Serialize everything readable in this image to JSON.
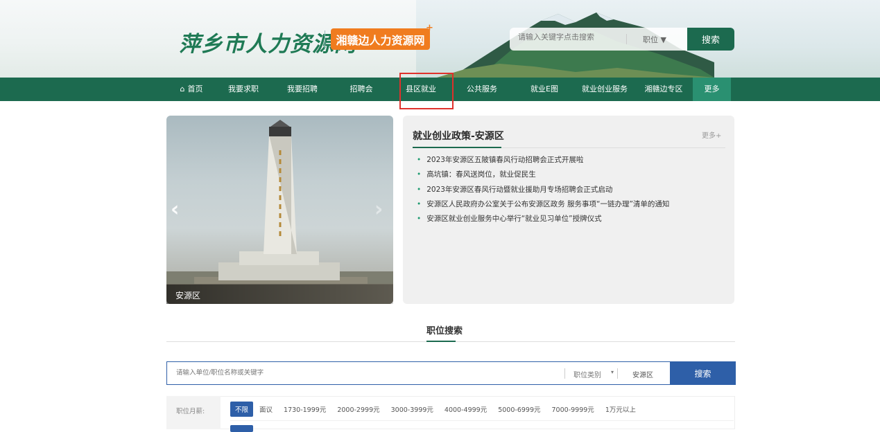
{
  "header": {
    "logo_text": "萍乡市人力资源网",
    "badge_text": "湘赣边人力资源网",
    "badge_plus": "+",
    "search_placeholder": "请输入关键字点击搜索",
    "search_category": "职位 ▼",
    "search_button": "搜索"
  },
  "nav": {
    "items": [
      {
        "label": "首页"
      },
      {
        "label": "我要求职"
      },
      {
        "label": "我要招聘"
      },
      {
        "label": "招聘会"
      },
      {
        "label": "县区就业"
      },
      {
        "label": "公共服务"
      },
      {
        "label": "就业E图"
      },
      {
        "label": "就业创业服务"
      },
      {
        "label": "湘赣边专区"
      },
      {
        "label": "更多"
      }
    ]
  },
  "banner": {
    "caption": "安源区",
    "prev": "‹",
    "next": "›"
  },
  "policy": {
    "title": "就业创业政策-安源区",
    "more": "更多+",
    "items": [
      "2023年安源区五陂镇春风行动招聘会正式开展啦",
      "高坑镇：春风送岗位，就业促民生",
      "2023年安源区春风行动暨就业援助月专场招聘会正式启动",
      "安源区人民政府办公室关于公布安源区政务 服务事项“一链办理”清单的通知",
      "安源区就业创业服务中心举行“就业见习单位”授牌仪式"
    ]
  },
  "job_search": {
    "title": "职位搜索",
    "placeholder": "请输入单位/职位名称或关键字",
    "category": "职位类别",
    "caret": "▾",
    "area": "安源区",
    "button": "搜索"
  },
  "salary_filter": {
    "label": "职位月薪:",
    "options": [
      "不限",
      "面议",
      "1730-1999元",
      "2000-2999元",
      "3000-3999元",
      "4000-4999元",
      "5000-6999元",
      "7000-9999元",
      "1万元以上"
    ]
  },
  "colors": {
    "brand_green": "#1c6a4f",
    "accent_orange": "#f07c1f",
    "search_blue": "#2e5fa8",
    "highlight_red": "#e0312b"
  }
}
